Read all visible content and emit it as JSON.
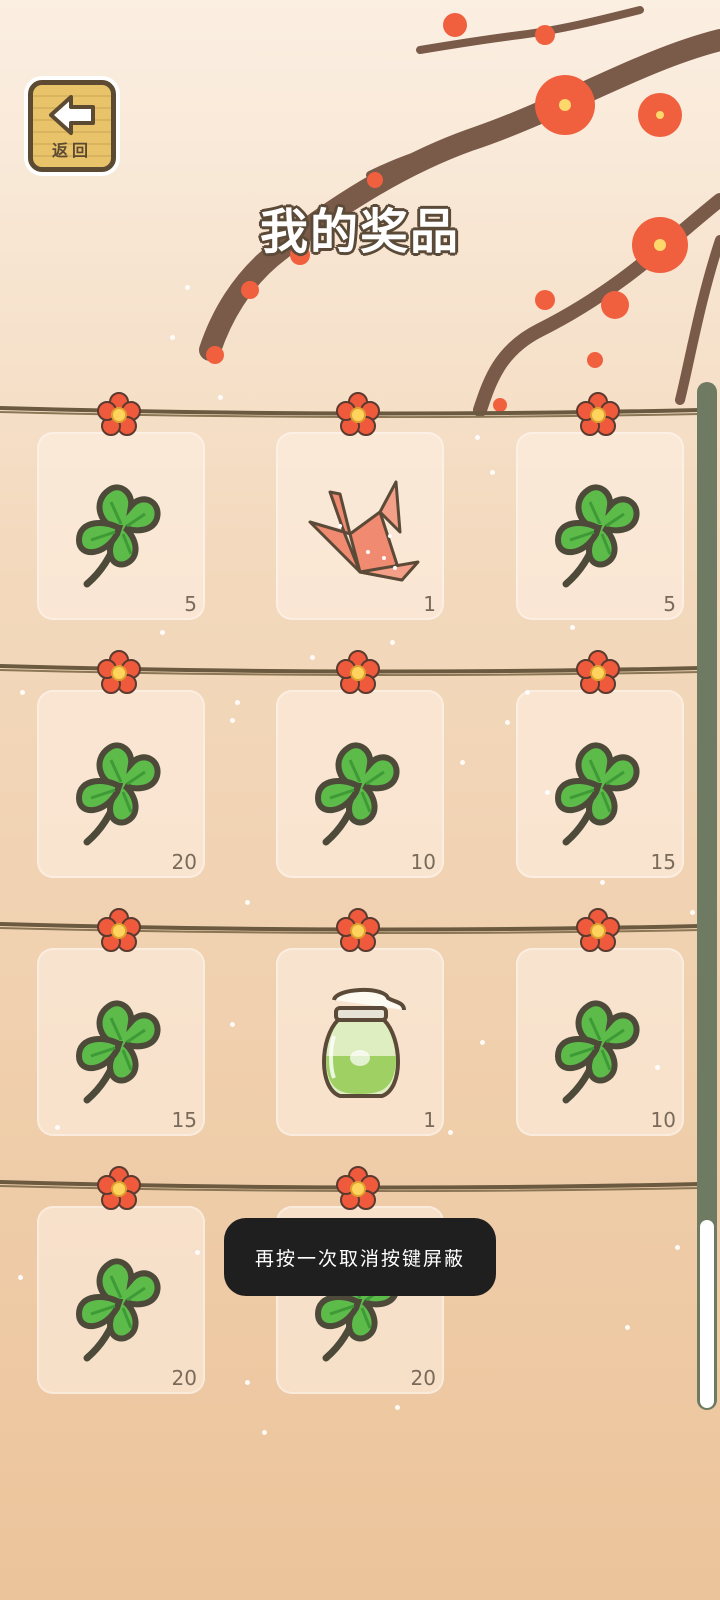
{
  "header": {
    "back_label": "返回",
    "title": "我的奖品"
  },
  "prizes": [
    {
      "icon": "clover",
      "count": "5"
    },
    {
      "icon": "paper-crane",
      "count": "1"
    },
    {
      "icon": "clover",
      "count": "5"
    },
    {
      "icon": "clover",
      "count": "20"
    },
    {
      "icon": "clover",
      "count": "10"
    },
    {
      "icon": "clover",
      "count": "15"
    },
    {
      "icon": "clover",
      "count": "15"
    },
    {
      "icon": "jar",
      "count": "1"
    },
    {
      "icon": "clover",
      "count": "10"
    },
    {
      "icon": "clover",
      "count": "20"
    },
    {
      "icon": "clover",
      "count": "20"
    }
  ],
  "toast": {
    "text": "再按一次取消按键屏蔽"
  },
  "colors": {
    "clover": "#5dbb4a",
    "outline": "#4d4a3a",
    "flower": "#ef5a3c",
    "rope": "#6b5a3f"
  }
}
